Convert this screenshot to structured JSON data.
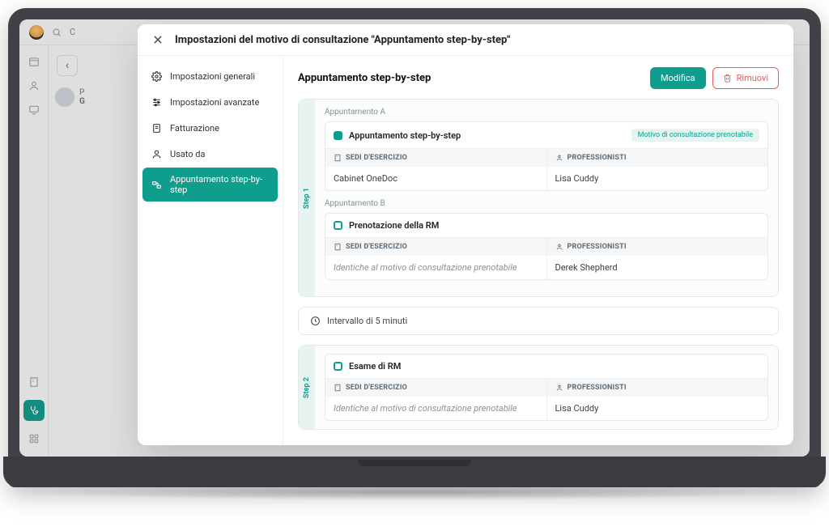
{
  "bg": {
    "search_placeholder": "C",
    "avatar_label_line1": "P",
    "avatar_label_line2": "G"
  },
  "modal": {
    "title": "Impostazioni del motivo di consultazione \"Appuntamento step-by-step\"",
    "nav": [
      "Impostazioni generali",
      "Impostazioni avanzate",
      "Fatturazione",
      "Usato da",
      "Appuntamento step-by-step"
    ],
    "content_title": "Appuntamento step-by-step",
    "edit_label": "Modifica",
    "remove_label": "Rimuovi",
    "col_locations": "SEDI D'ESERCIZIO",
    "col_professionals": "PROFESSIONISTI",
    "interval_label": "Intervallo di 5 minuti",
    "step1": {
      "label": "Step 1",
      "groupA": {
        "label": "Appuntamento A",
        "name": "Appuntamento step-by-step",
        "badge": "Motivo di consultazione prenotabile",
        "location": "Cabinet OneDoc",
        "professional": "Lisa Cuddy"
      },
      "groupB": {
        "label": "Appuntamento B",
        "name": "Prenotazione della RM",
        "location": "Identiche al motivo di consultazione prenotabile",
        "professional": "Derek Shepherd"
      }
    },
    "step2": {
      "label": "Step 2",
      "appt": {
        "name": "Esame di RM",
        "location": "Identiche al motivo di consultazione prenotabile",
        "professional": "Lisa Cuddy"
      }
    }
  }
}
